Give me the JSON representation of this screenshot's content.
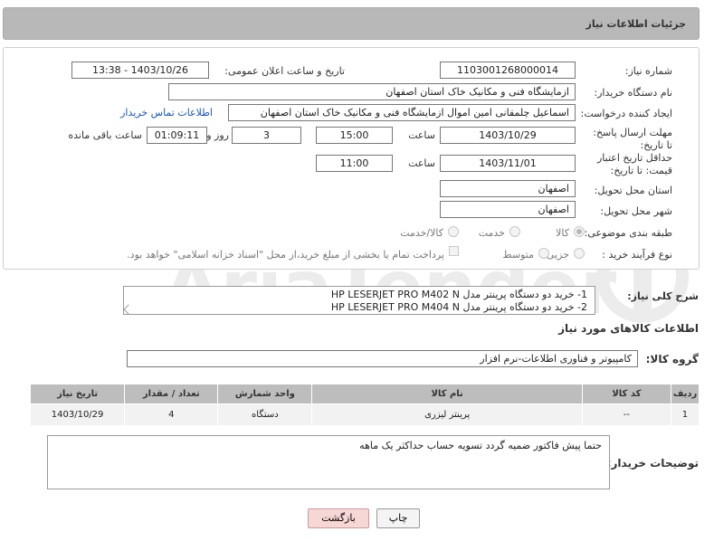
{
  "header": {
    "title": "جزئیات اطلاعات نیاز"
  },
  "form": {
    "need_number_label": "شماره نیاز:",
    "need_number": "1103001268000014",
    "announce_label": "تاریخ و ساعت اعلان عمومی:",
    "announce_value": "1403/10/26 - 13:38",
    "buyer_label": "نام دستگاه خریدار:",
    "buyer_value": "ازمایشگاه فنی و مکانیک خاک استان اصفهان",
    "creator_label": "ایجاد کننده درخواست:",
    "creator_value": "اسماعیل چلمقانی امین اموال ازمایشگاه فنی و مکانیک خاک استان اصفهان",
    "contact_link": "اطلاعات تماس خریدار",
    "reply_deadline_label": "مهلت ارسال پاسخ: تا تاریخ:",
    "reply_date": "1403/10/29",
    "time_label": "ساعت",
    "reply_time": "15:00",
    "days_value": "3",
    "days_label": "روز و",
    "remaining_time": "01:09:11",
    "remaining_label": "ساعت باقی مانده",
    "validity_label": "حداقل تاریخ اعتبار قیمت: تا تاریخ:",
    "validity_date": "1403/11/01",
    "validity_time_label": "ساعت",
    "validity_time": "11:00",
    "province_label": "استان محل تحویل:",
    "province_value": "اصفهان",
    "city_label": "شهر محل تحویل:",
    "city_value": "اصفهان",
    "category_label": "طبقه بندی موضوعی:",
    "category_options": [
      "کالا",
      "خدمت",
      "کالا/خدمت"
    ],
    "process_label": "نوع فرآیند خرید :",
    "process_options": [
      "جزیی",
      "متوسط"
    ],
    "payment_note": "پرداخت تمام یا بخشی از مبلغ خرید،از محل \"اسناد خزانه اسلامی\" خواهد بود."
  },
  "description": {
    "label": "شرح کلی نیاز:",
    "lines": [
      "1- خرید دو دستگاه پرینتر مدل  HP LESERJET PRO M402 N",
      "2- خرید دو دستگاه پرینتر مدل HP LESERJET PRO M404 N"
    ]
  },
  "goods": {
    "section_title": "اطلاعات کالاهای مورد نیاز",
    "group_label": "گروه کالا:",
    "group_value": "کامپیوتر و فناوری اطلاعات-نرم افزار",
    "columns": [
      "ردیف",
      "کد کالا",
      "نام کالا",
      "واحد شمارش",
      "تعداد / مقدار",
      "تاریخ نیاز"
    ],
    "rows": [
      [
        "1",
        "--",
        "پرینتر لیزری",
        "دستگاه",
        "4",
        "1403/10/29"
      ]
    ]
  },
  "notes": {
    "label": "توضیحات خریدار:",
    "value": "حتما پیش فاکتور ضمیه گردد تسویه حساب حداکثر یک ماهه"
  },
  "buttons": {
    "print": "چاپ",
    "back": "بازگشت"
  },
  "colors": {
    "header_bg": "#b8b8b8",
    "table_header_bg": "#bdbdbd",
    "link": "#1a55b8",
    "back_button_bg": "#f7d6d6"
  }
}
